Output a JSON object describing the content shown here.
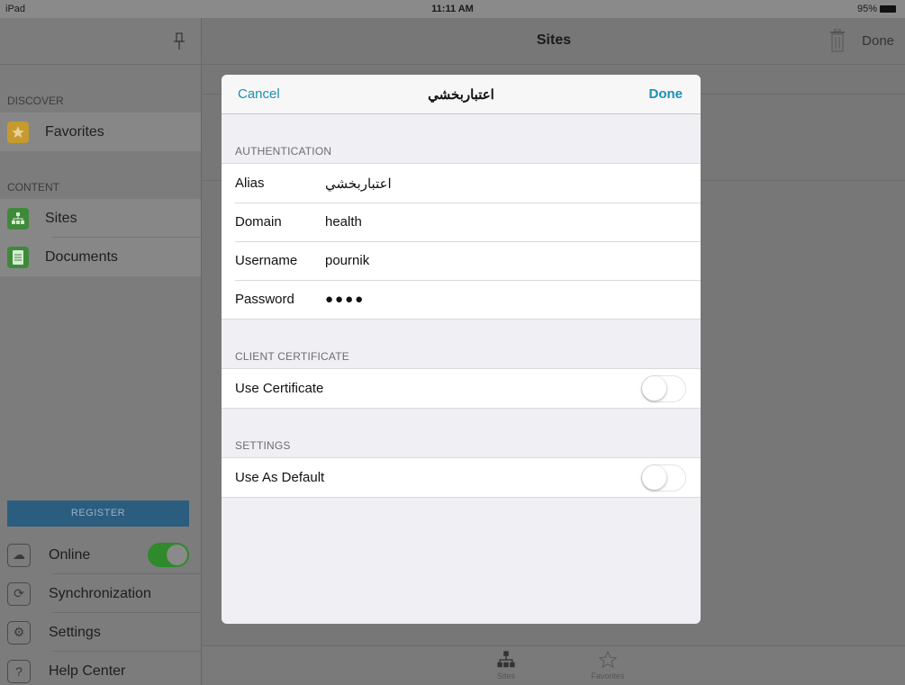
{
  "status_bar": {
    "device": "iPad",
    "time": "11:11 AM",
    "battery": "95%"
  },
  "sidebar": {
    "discover_label": "DISCOVER",
    "discover_items": [
      {
        "label": "Favorites",
        "icon": "star-icon",
        "color": "#c79a2e"
      }
    ],
    "content_label": "CONTENT",
    "content_items": [
      {
        "label": "Sites",
        "icon": "sitemap-icon",
        "color": "#3f8a3a"
      },
      {
        "label": "Documents",
        "icon": "document-icon",
        "color": "#3f8a3a"
      }
    ],
    "register_label": "REGISTER",
    "bottom_items": [
      {
        "label": "Online",
        "icon": "cloud-icon"
      },
      {
        "label": "Synchronization",
        "icon": "sync-icon"
      },
      {
        "label": "Settings",
        "icon": "gear-icon"
      },
      {
        "label": "Help Center",
        "icon": "help-icon"
      }
    ],
    "online_enabled": true
  },
  "main": {
    "title": "Sites",
    "done_label": "Done",
    "tabs": [
      {
        "label": "Sites",
        "icon": "sitemap-icon"
      },
      {
        "label": "Favorites",
        "icon": "star-outline-icon"
      }
    ]
  },
  "modal": {
    "cancel_label": "Cancel",
    "title": "اعتباربخشي",
    "done_label": "Done",
    "authentication_header": "AUTHENTICATION",
    "fields": [
      {
        "label": "Alias",
        "value": "اعتباربخشي"
      },
      {
        "label": "Domain",
        "value": "health"
      },
      {
        "label": "Username",
        "value": "pournik"
      },
      {
        "label": "Password",
        "value": "●●●●"
      }
    ],
    "certificate_header": "CLIENT CERTIFICATE",
    "use_certificate_label": "Use Certificate",
    "use_certificate_on": false,
    "settings_header": "SETTINGS",
    "use_default_label": "Use As Default",
    "use_default_on": false,
    "accent_color": "#1a8fb5"
  }
}
